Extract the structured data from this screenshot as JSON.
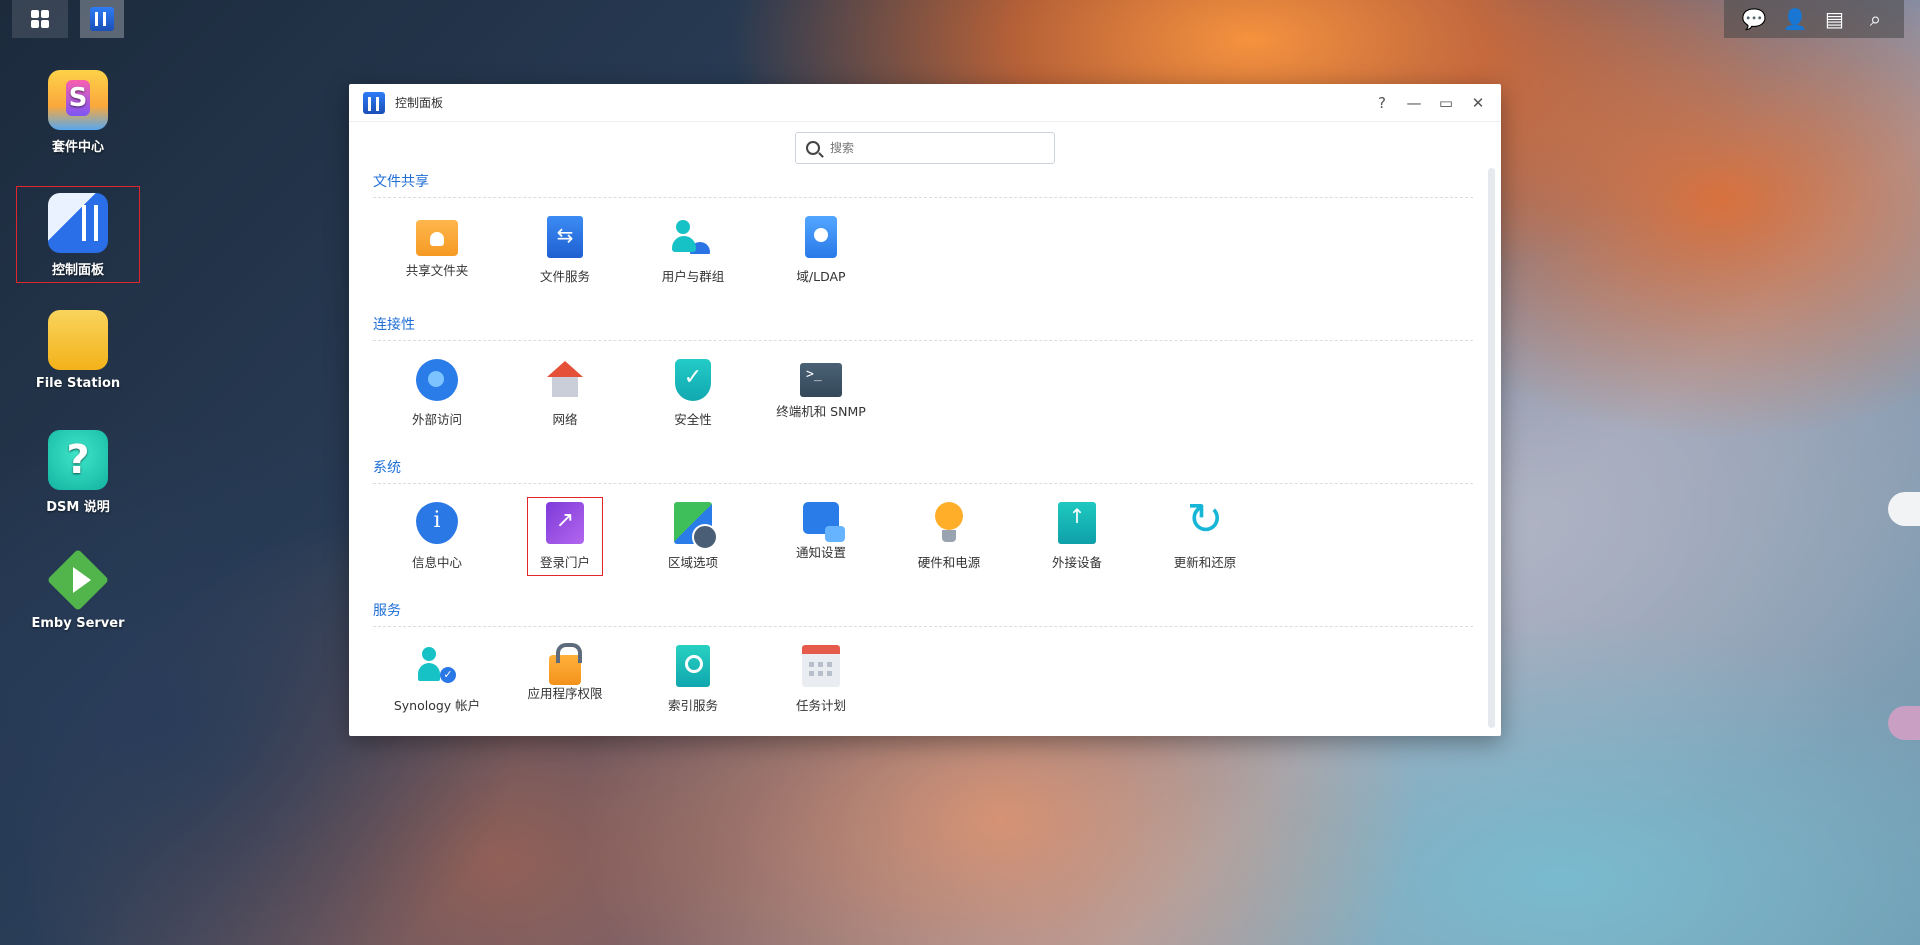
{
  "taskbar": {
    "left_buttons": [
      "main-menu",
      "control-panel-task"
    ],
    "right_icons": [
      "chat-icon",
      "user-icon",
      "widgets-icon",
      "search-icon"
    ]
  },
  "desktop": {
    "icons": [
      {
        "label": "套件中心"
      },
      {
        "label": "控制面板"
      },
      {
        "label": "File Station"
      },
      {
        "label": "DSM 说明"
      },
      {
        "label": "Emby Server"
      }
    ]
  },
  "window": {
    "title": "控制面板",
    "controls": {
      "help": "?",
      "minimize": "—",
      "maximize": "▭",
      "close": "✕"
    },
    "search": {
      "placeholder": "搜索",
      "value": ""
    },
    "sections": [
      {
        "title": "文件共享",
        "items": [
          "共享文件夹",
          "文件服务",
          "用户与群组",
          "域/LDAP"
        ]
      },
      {
        "title": "连接性",
        "items": [
          "外部访问",
          "网络",
          "安全性",
          "终端机和 SNMP"
        ]
      },
      {
        "title": "系统",
        "items": [
          "信息中心",
          "登录门户",
          "区域选项",
          "通知设置",
          "硬件和电源",
          "外接设备",
          "更新和还原"
        ]
      },
      {
        "title": "服务",
        "items": [
          "Synology 帐户",
          "应用程序权限",
          "索引服务",
          "任务计划"
        ]
      }
    ]
  },
  "colors": {
    "section_title": "#1f6fd6",
    "selection_outline": "#e3262c"
  }
}
